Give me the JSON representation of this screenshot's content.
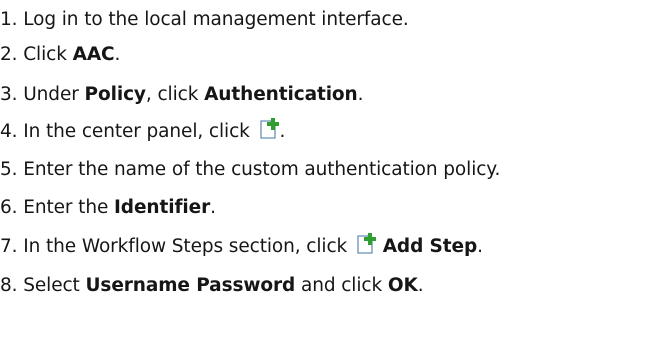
{
  "steps": [
    {
      "num": "1.",
      "parts": [
        {
          "t": "Log in to the local management interface."
        }
      ]
    },
    {
      "num": "2.",
      "parts": [
        {
          "t": "Click "
        },
        {
          "t": "AAC",
          "b": true
        },
        {
          "t": "."
        }
      ]
    },
    {
      "num": "3.",
      "parts": [
        {
          "t": "Under "
        },
        {
          "t": "Policy",
          "b": true
        },
        {
          "t": ", click "
        },
        {
          "t": "Authentication",
          "b": true
        },
        {
          "t": "."
        }
      ]
    },
    {
      "num": "4.",
      "parts": [
        {
          "t": "In the center panel, click "
        },
        {
          "icon": "add-document-icon"
        },
        {
          "t": "."
        }
      ]
    },
    {
      "num": "5.",
      "parts": [
        {
          "t": "Enter the name of the custom authentication policy."
        }
      ]
    },
    {
      "num": "6.",
      "parts": [
        {
          "t": "Enter the "
        },
        {
          "t": "Identifier",
          "b": true
        },
        {
          "t": "."
        }
      ]
    },
    {
      "num": "7.",
      "parts": [
        {
          "t": "In the Workflow Steps section, click "
        },
        {
          "icon": "add-document-icon"
        },
        {
          "t": " "
        },
        {
          "t": "Add Step",
          "b": true
        },
        {
          "t": "."
        }
      ]
    },
    {
      "num": "8.",
      "parts": [
        {
          "t": "Select "
        },
        {
          "t": "Username Password",
          "b": true
        },
        {
          "t": " and click "
        },
        {
          "t": "OK",
          "b": true
        },
        {
          "t": "."
        }
      ]
    }
  ],
  "colors": {
    "text": "#161616",
    "icon_plus": "#2e9e2e",
    "icon_doc_border": "#6b8fb8"
  }
}
